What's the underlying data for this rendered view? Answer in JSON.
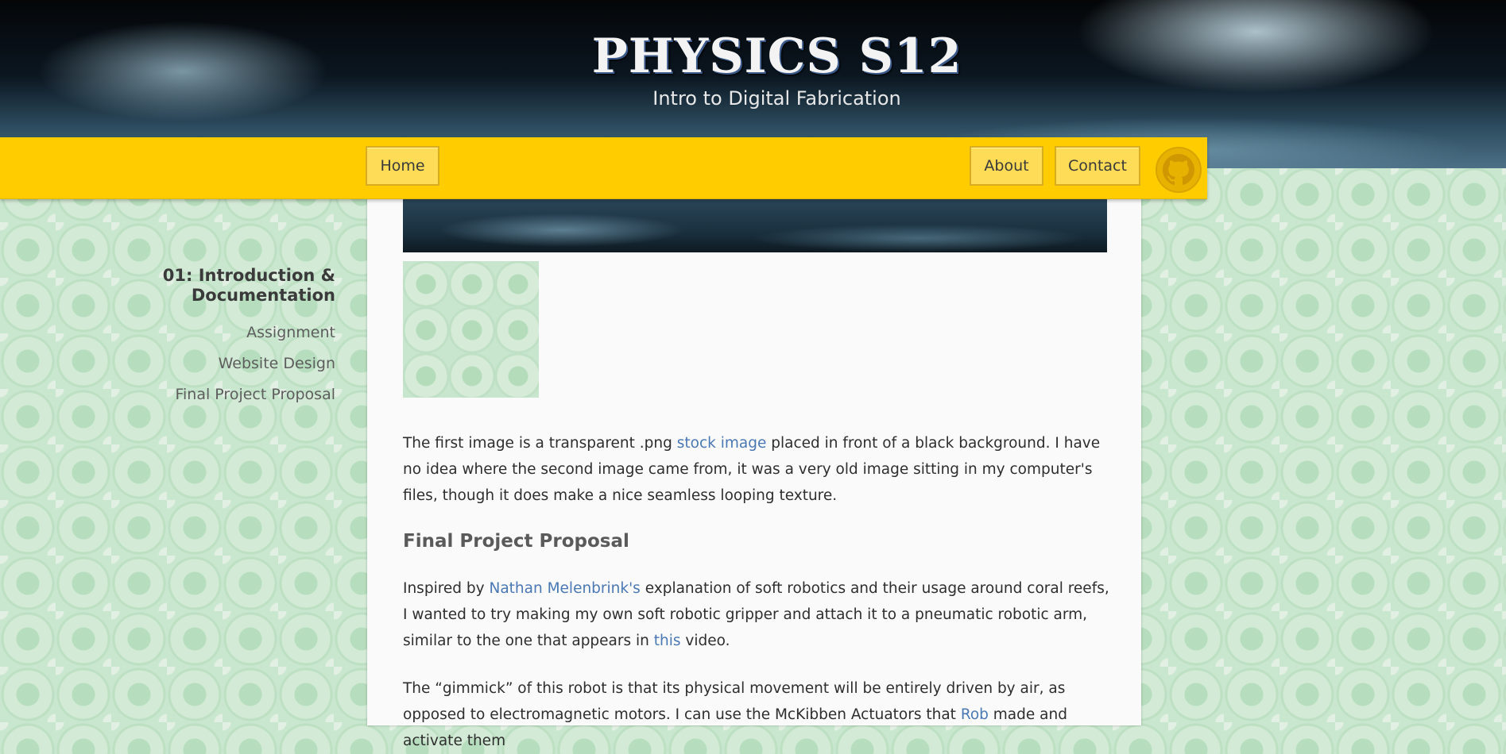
{
  "header": {
    "title": "PHYSICS S12",
    "subtitle": "Intro to Digital Fabrication"
  },
  "nav": {
    "home": "Home",
    "about": "About",
    "contact": "Contact",
    "github_icon": "github-icon"
  },
  "sidebar": {
    "heading": "01: Introduction & Documentation",
    "items": [
      "Assignment",
      "Website Design",
      "Final Project Proposal"
    ]
  },
  "main": {
    "p1": {
      "t1": "The first image is a transparent .png ",
      "link1": "stock image",
      "t2": " placed in front of a black background. I have no idea where the second image came from, it was a very old image sitting in my computer's files, though it does make a nice seamless looping texture."
    },
    "heading": "Final Project Proposal",
    "p2": {
      "t1": "Inspired by ",
      "link1": "Nathan Melenbrink's",
      "t2": " explanation of soft robotics and their usage around coral reefs, I wanted to try making my own soft robotic gripper and attach it to a pneumatic robotic arm, similar to the one that appears in ",
      "link2": "this",
      "t3": " video."
    },
    "p3": {
      "t1": "The “gimmick” of this robot is that its physical movement will be entirely driven by air, as opposed to electromagnetic motors. I can use the McKibben Actuators that ",
      "link1": "Rob",
      "t2": " made and activate them"
    }
  },
  "colors": {
    "navbar": "#ffcc00",
    "link": "#4a78b4",
    "content_bg": "#fafafa"
  }
}
